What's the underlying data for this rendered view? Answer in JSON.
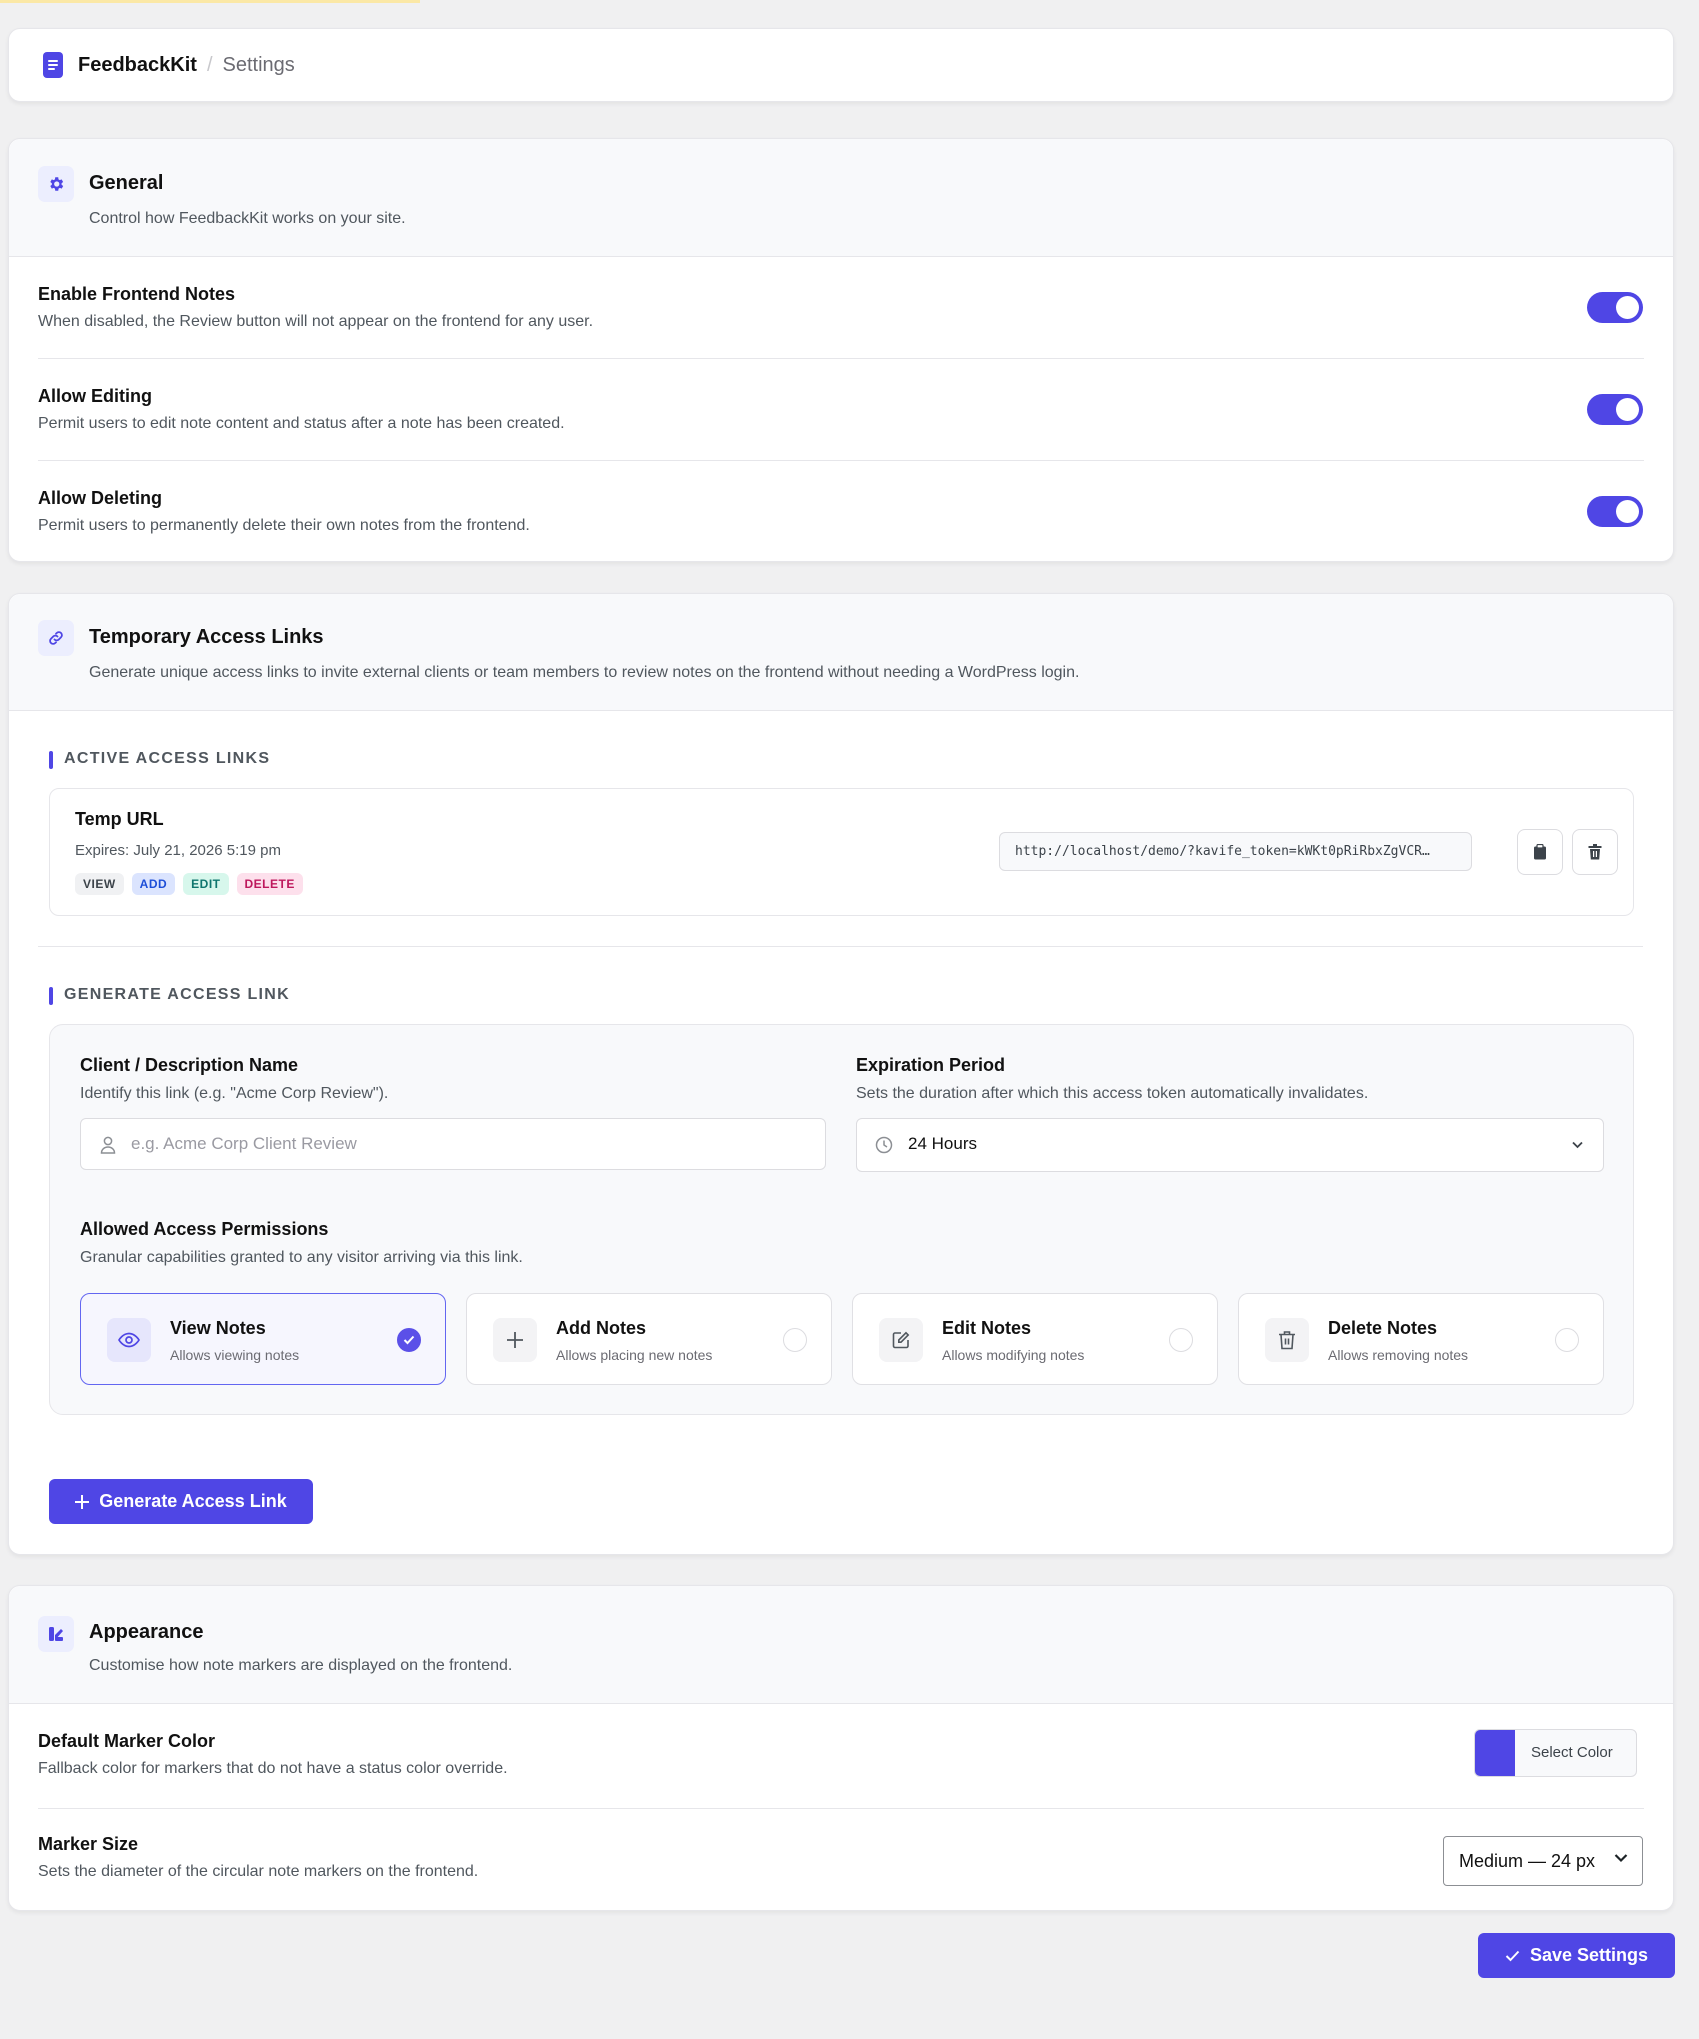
{
  "header": {
    "brand": "FeedbackKit",
    "separator": "/",
    "crumb": "Settings"
  },
  "general": {
    "title": "General",
    "description": "Control how FeedbackKit works on your site.",
    "rows": [
      {
        "title": "Enable Frontend Notes",
        "description": "When disabled, the Review button will not appear on the frontend for any user.",
        "enabled": true
      },
      {
        "title": "Allow Editing",
        "description": "Permit users to edit note content and status after a note has been created.",
        "enabled": true
      },
      {
        "title": "Allow Deleting",
        "description": "Permit users to permanently delete their own notes from the frontend.",
        "enabled": true
      }
    ]
  },
  "access": {
    "title": "Temporary Access Links",
    "description": "Generate unique access links to invite external clients or team members to review notes on the frontend without needing a WordPress login.",
    "active_heading": "ACTIVE ACCESS LINKS",
    "link": {
      "name": "Temp URL",
      "expires": "Expires: July 21, 2026 5:19 pm",
      "tags": [
        "VIEW",
        "ADD",
        "EDIT",
        "DELETE"
      ],
      "url": "http://localhost/demo/?kavife_token=kWKt0pRiRbxZgVCR…"
    },
    "generate_heading": "GENERATE ACCESS LINK",
    "form": {
      "client_label": "Client / Description Name",
      "client_help": "Identify this link (e.g. \"Acme Corp Review\").",
      "client_placeholder": "e.g. Acme Corp Client Review",
      "client_value": "",
      "expiry_label": "Expiration Period",
      "expiry_help": "Sets the duration after which this access token automatically invalidates.",
      "expiry_value": "24 Hours",
      "perm_label": "Allowed Access Permissions",
      "perm_help": "Granular capabilities granted to any visitor arriving via this link.",
      "permissions": [
        {
          "title": "View Notes",
          "sub": "Allows viewing notes",
          "selected": true,
          "icon": "eye-icon"
        },
        {
          "title": "Add Notes",
          "sub": "Allows placing new notes",
          "selected": false,
          "icon": "plus-icon"
        },
        {
          "title": "Edit Notes",
          "sub": "Allows modifying notes",
          "selected": false,
          "icon": "edit-icon"
        },
        {
          "title": "Delete Notes",
          "sub": "Allows removing notes",
          "selected": false,
          "icon": "trash-icon"
        }
      ]
    },
    "generate_button": "Generate Access Link"
  },
  "appearance": {
    "title": "Appearance",
    "description": "Customise how note markers are displayed on the frontend.",
    "marker_color_title": "Default Marker Color",
    "marker_color_desc": "Fallback color for markers that do not have a status color override.",
    "marker_color": "#4f46e5",
    "select_color_label": "Select Color",
    "marker_size_title": "Marker Size",
    "marker_size_desc": "Sets the diameter of the circular note markers on the frontend.",
    "marker_size_value": "Medium — 24 px"
  },
  "save_button": "Save Settings",
  "colors": {
    "accent": "#4f46e5",
    "background": "#f0f0f1"
  }
}
